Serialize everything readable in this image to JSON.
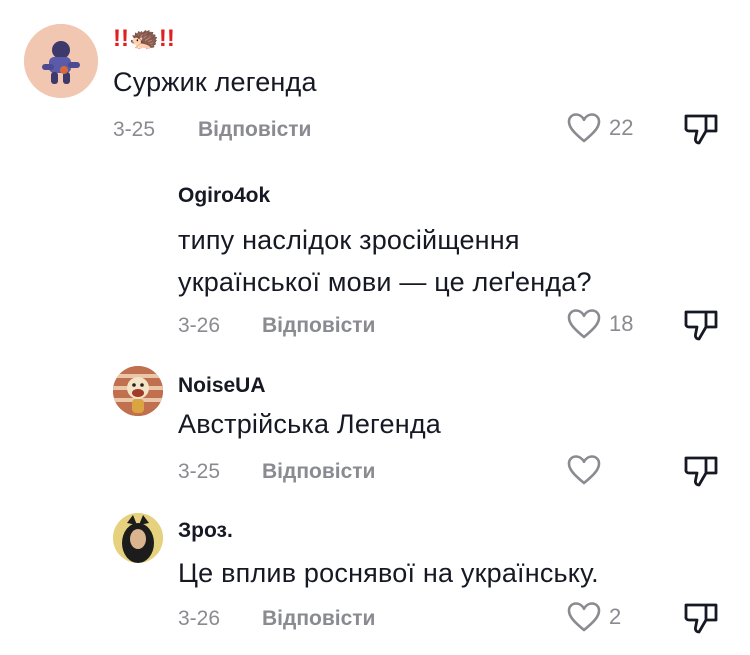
{
  "comments": [
    {
      "username": "!!🦔!!",
      "text": "Суржик легенда",
      "date": "3-25",
      "reply_label": "Відповісти",
      "likes": "22"
    },
    {
      "username": "Ogiro4ok",
      "text_line1": "типу наслідок зросійщення",
      "text_line2": "української мови — це леґенда?",
      "date": "3-26",
      "reply_label": "Відповісти",
      "likes": "18"
    },
    {
      "username": "NoiseUA",
      "text": "Австрійська Легенда",
      "date": "3-25",
      "reply_label": "Відповісти",
      "likes": ""
    },
    {
      "username": "Зроз.",
      "text": "Це вплив роснявої на українську.",
      "date": "3-26",
      "reply_label": "Відповісти",
      "likes": "2"
    }
  ],
  "colors": {
    "text": "#161823",
    "muted": "#8a8b91",
    "username_emoji_red": "#e02020"
  }
}
